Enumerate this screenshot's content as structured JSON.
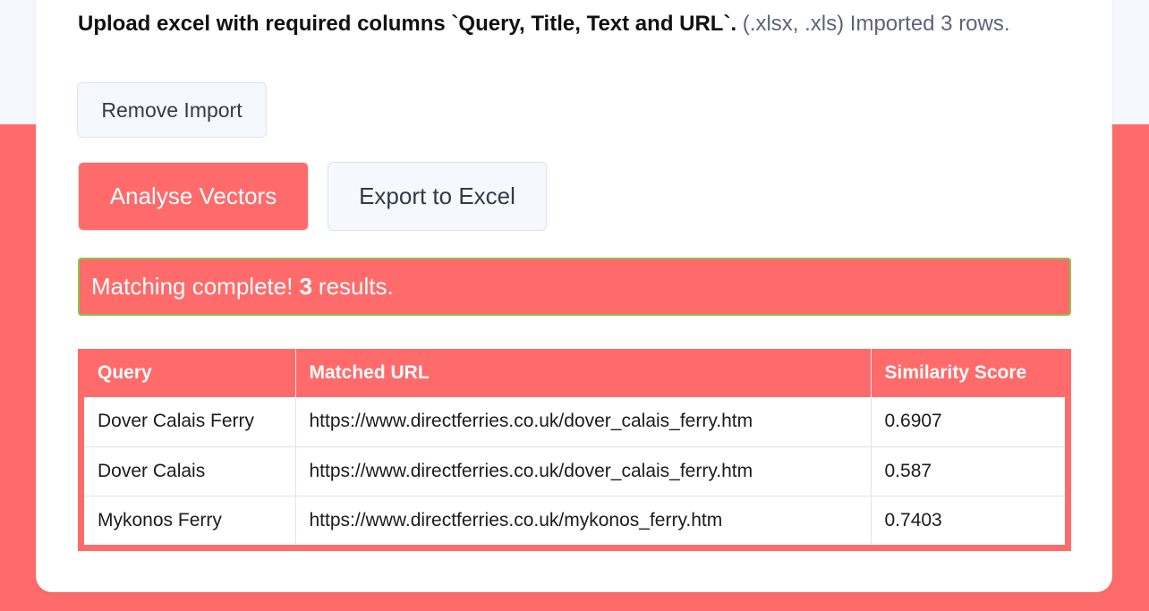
{
  "upload": {
    "bold_text": "Upload excel with required columns `Query, Title, Text and URL`.",
    "formats": "(.xlsx, .xls)",
    "status": "Imported 3 rows."
  },
  "buttons": {
    "remove_import": "Remove Import",
    "analyse": "Analyse Vectors",
    "export": "Export to Excel"
  },
  "alert": {
    "prefix": "Matching complete!",
    "count": "3",
    "suffix": "results."
  },
  "results_table": {
    "headers": [
      "Query",
      "Matched URL",
      "Similarity Score"
    ],
    "rows": [
      [
        "Dover Calais Ferry",
        "https://www.directferries.co.uk/dover_calais_ferry.htm",
        "0.6907"
      ],
      [
        "Dover Calais",
        "https://www.directferries.co.uk/dover_calais_ferry.htm",
        "0.587"
      ],
      [
        "Mykonos Ferry",
        "https://www.directferries.co.uk/mykonos_ferry.htm",
        "0.7403"
      ]
    ]
  },
  "colors": {
    "accent": "#ff6b6b",
    "page_top": "#f5f8fd",
    "alert_border": "#8bc34a"
  }
}
